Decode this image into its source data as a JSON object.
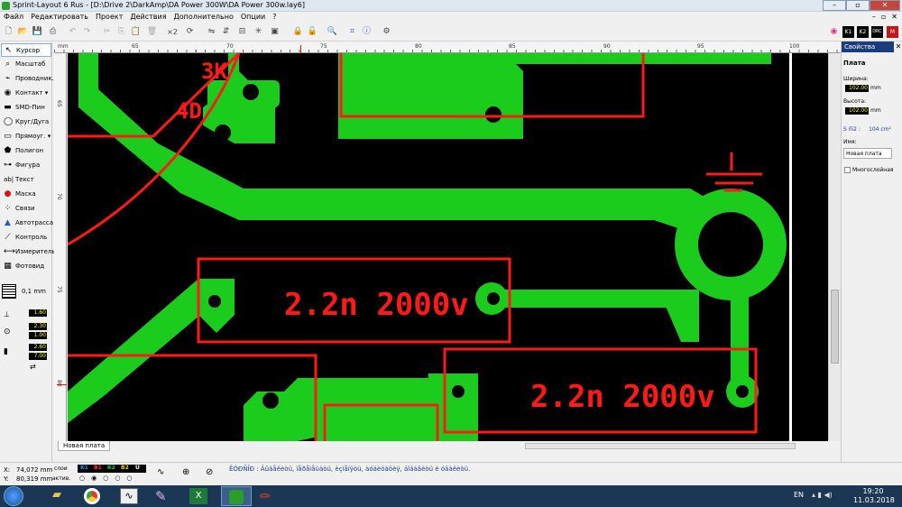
{
  "window": {
    "title": "Sprint-Layout 6 Rus - [D:\\Drive 2\\DarkAmp\\DA Power 300W\\DA Power 300w.lay6]"
  },
  "menu": [
    "Файл",
    "Редактировать",
    "Проект",
    "Действия",
    "Дополнительно",
    "Опции",
    "?"
  ],
  "toolbar": {
    "zoom_label": "×2"
  },
  "tools": [
    {
      "label": "Курсор",
      "icon": "cursor-icon",
      "selected": true
    },
    {
      "label": "Масштаб",
      "icon": "zoom-icon"
    },
    {
      "label": "Проводник.",
      "icon": "track-icon"
    },
    {
      "label": "Контакт",
      "icon": "pad-icon"
    },
    {
      "label": "SMD-Пин",
      "icon": "smd-pad-icon"
    },
    {
      "label": "Круг/Дуга",
      "icon": "circle-icon"
    },
    {
      "label": "Прямоуг.",
      "icon": "rectangle-icon"
    },
    {
      "label": "Полигон",
      "icon": "polygon-icon"
    },
    {
      "label": "Фигура",
      "icon": "shape-icon"
    },
    {
      "label": "Текст",
      "icon": "text-icon"
    },
    {
      "label": "Маска",
      "icon": "mask-icon"
    },
    {
      "label": "Связи",
      "icon": "connections-icon"
    },
    {
      "label": "Автотрасса",
      "icon": "autoroute-icon"
    },
    {
      "label": "Контроль",
      "icon": "check-icon"
    },
    {
      "label": "Измеритель",
      "icon": "measure-icon"
    },
    {
      "label": "Фотовид",
      "icon": "photoview-icon"
    }
  ],
  "grid": {
    "value": "0,1 mm"
  },
  "track_width": "1.60",
  "pad_outer": "2.30",
  "pad_inner": "1.00",
  "smd_w": "2.60",
  "smd_h": "7.00",
  "ruler": {
    "unit": "mm",
    "h_labels": [
      "65",
      "70",
      "75",
      "80",
      "85",
      "90",
      "95",
      "100"
    ],
    "v_labels": [
      "65",
      "70",
      "75",
      "80"
    ]
  },
  "pcb": {
    "labels": [
      "2.2n 2000v",
      "2.2n 2000v"
    ],
    "silk_text": [
      "3K",
      "4D"
    ]
  },
  "right_panel": {
    "tab": "Свойства",
    "section": "Плата",
    "width_label": "Ширина:",
    "width_value": "102.00",
    "width_unit": "mm",
    "height_label": "Высота:",
    "height_value": "102.00",
    "height_unit": "mm",
    "area_label": "S ñï2 :",
    "area_value": "104 cm²",
    "name_label": "Имя:",
    "name_value": "Новая плата",
    "multilayer_label": "Многослойная"
  },
  "tabs": [
    "Новая плата"
  ],
  "status": {
    "x_label": "X:",
    "x_value": "74,072 mm",
    "y_label": "Y:",
    "y_value": "80,319 mm",
    "layers_label": "слои",
    "active_label": "актив.",
    "layers": [
      "K1",
      "B1",
      "K2",
      "B2",
      "U"
    ],
    "hint": "ÊÓÐÑÎÐ : Âûäåëèòü, ïåðåìåùàòü, èçìåíÿòü, àóäèöàöèÿ, äîáàâèòü è óäàëèòü."
  },
  "taskbar": {
    "lang": "EN",
    "time": "19:20",
    "date": "11.03.2018"
  },
  "colors": {
    "copper": "#1ccc1c",
    "silk": "#ff1a1a",
    "board": "#000000"
  }
}
